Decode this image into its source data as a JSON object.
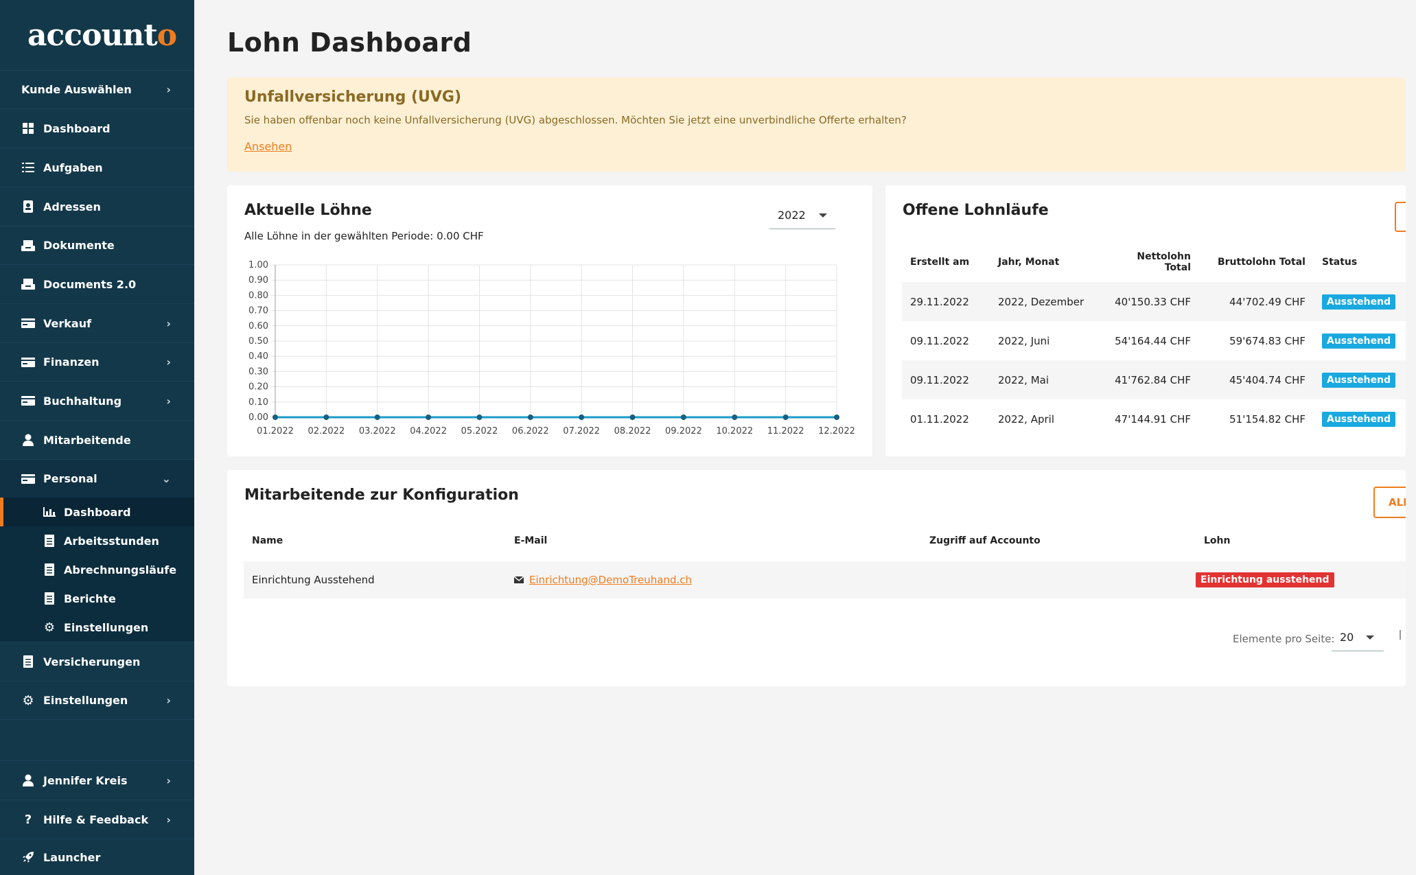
{
  "brand": {
    "logo_main": "account",
    "logo_accent": "o"
  },
  "sidebar": {
    "items": [
      {
        "label": "Kunde Auswählen",
        "icon": "none",
        "chevron": "›"
      },
      {
        "label": "Dashboard",
        "icon": "grid-icon"
      },
      {
        "label": "Aufgaben",
        "icon": "list-icon"
      },
      {
        "label": "Adressen",
        "icon": "contact-book-icon"
      },
      {
        "label": "Dokumente",
        "icon": "inbox-icon"
      },
      {
        "label": "Documents 2.0",
        "icon": "inbox-icon"
      },
      {
        "label": "Verkauf",
        "icon": "card-icon",
        "chevron": "›"
      },
      {
        "label": "Finanzen",
        "icon": "card-icon",
        "chevron": "›"
      },
      {
        "label": "Buchhaltung",
        "icon": "card-icon",
        "chevron": "›"
      },
      {
        "label": "Mitarbeitende",
        "icon": "person-icon"
      },
      {
        "label": "Personal",
        "icon": "card-icon",
        "chevron": "⌄"
      }
    ],
    "sub_items": [
      {
        "label": "Dashboard",
        "icon": "bar-chart-icon"
      },
      {
        "label": "Arbeitsstunden",
        "icon": "document-icon"
      },
      {
        "label": "Abrechnungsläufe",
        "icon": "document-icon"
      },
      {
        "label": "Berichte",
        "icon": "document-icon"
      },
      {
        "label": "Einstellungen",
        "icon": "gear-icon"
      }
    ],
    "lower_items": [
      {
        "label": "Versicherungen",
        "icon": "document-icon"
      },
      {
        "label": "Einstellungen",
        "icon": "gear-icon",
        "chevron": "›"
      }
    ],
    "bottom_items": [
      {
        "label": "Jennifer Kreis",
        "icon": "person-icon",
        "chevron": "›"
      },
      {
        "label": "Hilfe & Feedback",
        "icon": "question-icon",
        "chevron": "›"
      },
      {
        "label": "Launcher",
        "icon": "rocket-icon"
      }
    ]
  },
  "page": {
    "title": "Lohn Dashboard"
  },
  "alert": {
    "title": "Unfallversicherung (UVG)",
    "text": "Sie haben offenbar noch keine Unfallversicherung (UVG) abgeschlossen. Möchten Sie jetzt eine unverbindliche Offerte erhalten?",
    "link": "Ansehen"
  },
  "wages": {
    "title": "Aktuelle Löhne",
    "year": "2022",
    "subtitle": "Alle Löhne in der gewählten Periode: 0.00 CHF"
  },
  "chart_data": {
    "type": "line",
    "categories": [
      "01.2022",
      "02.2022",
      "03.2022",
      "04.2022",
      "05.2022",
      "06.2022",
      "07.2022",
      "08.2022",
      "09.2022",
      "10.2022",
      "11.2022",
      "12.2022"
    ],
    "values": [
      0,
      0,
      0,
      0,
      0,
      0,
      0,
      0,
      0,
      0,
      0,
      0
    ],
    "yticks": [
      "0.00",
      "0.10",
      "0.20",
      "0.30",
      "0.40",
      "0.50",
      "0.60",
      "0.70",
      "0.80",
      "0.90",
      "1.00"
    ],
    "ylim": [
      0,
      1
    ],
    "grid": true,
    "color": "#1a9bc7"
  },
  "payruns": {
    "title": "Offene Lohnläufe",
    "headers": [
      "Erstellt am",
      "Jahr, Monat",
      "Nettolohn Total",
      "Bruttolohn Total",
      "Status"
    ],
    "rows": [
      [
        "29.11.2022",
        "2022, Dezember",
        "40'150.33 CHF",
        "44'702.49 CHF",
        "Ausstehend"
      ],
      [
        "09.11.2022",
        "2022, Juni",
        "54'164.44 CHF",
        "59'674.83 CHF",
        "Ausstehend"
      ],
      [
        "09.11.2022",
        "2022, Mai",
        "41'762.84 CHF",
        "45'404.74 CHF",
        "Ausstehend"
      ],
      [
        "01.11.2022",
        "2022, April",
        "47'144.91 CHF",
        "51'154.82 CHF",
        "Ausstehend"
      ]
    ],
    "status_color": "#19a9e0"
  },
  "employees": {
    "title": "Mitarbeitende zur Konfiguration",
    "button": "ALL",
    "headers": [
      "Name",
      "E-Mail",
      "Zugriff auf Accounto",
      "Lohn"
    ],
    "rows": [
      {
        "name": "Einrichtung Ausstehend",
        "email": "Einrichtung@DemoTreuhand.ch",
        "access": "",
        "lohn": "Einrichtung ausstehend"
      }
    ],
    "pager_label": "Elemente pro Seite:",
    "pager_value": "20"
  },
  "colors": {
    "sidebar": "#13384a",
    "accent": "#f07c1e",
    "danger": "#e23333"
  }
}
